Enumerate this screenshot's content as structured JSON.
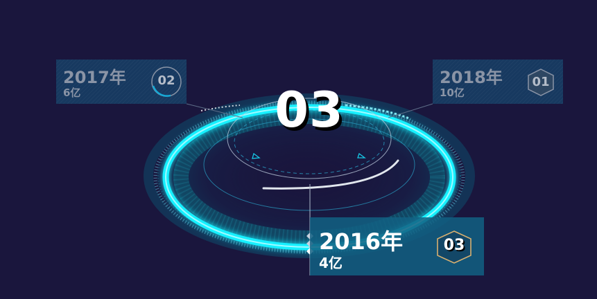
{
  "center_display": {
    "value": "03"
  },
  "panels": {
    "p2017": {
      "year": "2017年",
      "amount": "6亿",
      "badge": "02",
      "badge_shape": "circle"
    },
    "p2018": {
      "year": "2018年",
      "amount": "10亿",
      "badge": "01",
      "badge_shape": "hexagon"
    },
    "p2016": {
      "year": "2016年",
      "amount": "4亿",
      "badge": "03",
      "badge_shape": "hexagon",
      "active": true
    }
  },
  "colors": {
    "background": "#1a163d",
    "ring_glow": "#16f0ff",
    "panel": "#16466e",
    "active_panel": "#126082",
    "badge_active_outline": "#d8b070",
    "badge_inactive": "#8a94a6"
  }
}
